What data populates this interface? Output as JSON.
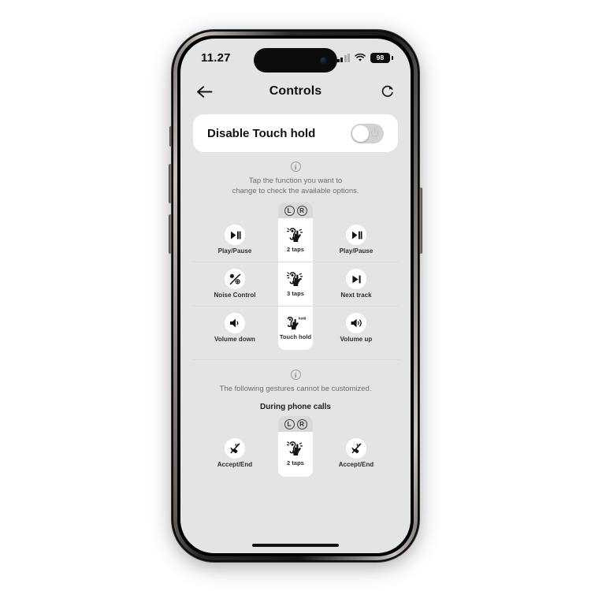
{
  "status_bar": {
    "time": "11.27",
    "battery_percent": "98",
    "signal_icon": "cellular-signal-icon",
    "wifi_icon": "wifi-icon",
    "battery_icon": "battery-icon"
  },
  "nav": {
    "title": "Controls",
    "back_icon": "back-arrow-icon",
    "reset_icon": "reset-refresh-icon"
  },
  "toggle_card": {
    "label": "Disable Touch hold",
    "state": "off"
  },
  "info_top": {
    "icon": "info-circle-icon",
    "line1": "Tap the function you want to",
    "line2": "change to check the available options."
  },
  "earbud_header": {
    "left": "L",
    "right": "R"
  },
  "gesture_grid": {
    "rows": [
      {
        "left_label": "Play/Pause",
        "left_icon": "play-pause-icon",
        "mid_label": "2 taps",
        "mid_icon": "ear-two-tap-icon",
        "right_label": "Play/Pause",
        "right_icon": "play-pause-icon"
      },
      {
        "left_label": "Noise Control",
        "left_icon": "noise-control-icon",
        "mid_label": "3 taps",
        "mid_icon": "ear-three-tap-icon",
        "right_label": "Next track",
        "right_icon": "next-track-icon"
      },
      {
        "left_label": "Volume down",
        "left_icon": "volume-down-icon",
        "mid_label": "Touch hold",
        "mid_icon": "touch-hold-icon",
        "right_label": "Volume up",
        "right_icon": "volume-up-icon"
      }
    ]
  },
  "info_bottom": {
    "icon": "info-circle-icon",
    "line1": "The following gestures cannot be customized."
  },
  "calls_section": {
    "title": "During phone calls",
    "earbud_left": "L",
    "earbud_right": "R",
    "row": {
      "left_label": "Accept/End",
      "left_icon": "accept-end-call-icon",
      "mid_label": "2 taps",
      "mid_icon": "ear-two-tap-icon",
      "right_label": "Accept/End",
      "right_icon": "accept-end-call-icon"
    }
  },
  "colors": {
    "screen_bg": "#e4e4e4",
    "card_bg": "#ffffff",
    "text_primary": "#111111",
    "text_secondary": "#6e6e6e",
    "toggle_track_off": "#d2d2d2"
  }
}
